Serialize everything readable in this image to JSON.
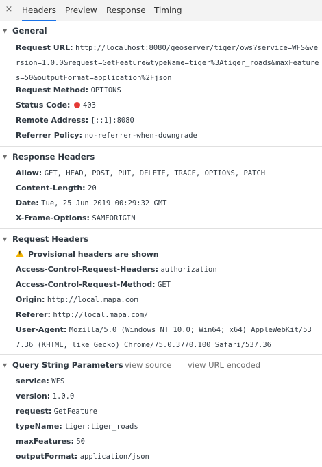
{
  "tabs": {
    "close_symbol": "×",
    "items": [
      "Headers",
      "Preview",
      "Response",
      "Timing"
    ],
    "active": "Headers"
  },
  "general": {
    "title": "General",
    "request_url_key": "Request URL:",
    "request_url_value": "http://localhost:8080/geoserver/tiger/ows?service=WFS&version=1.0.0&request=GetFeature&typeName=tiger%3Atiger_roads&maxFeatures=50&outputFormat=application%2Fjson",
    "request_method_key": "Request Method:",
    "request_method_value": "OPTIONS",
    "status_code_key": "Status Code:",
    "status_code_value": "403",
    "status_color": "#e53935",
    "remote_address_key": "Remote Address:",
    "remote_address_value": "[::1]:8080",
    "referrer_policy_key": "Referrer Policy:",
    "referrer_policy_value": "no-referrer-when-downgrade"
  },
  "response_headers": {
    "title": "Response Headers",
    "rows": [
      {
        "k": "Allow:",
        "v": "GET, HEAD, POST, PUT, DELETE, TRACE, OPTIONS, PATCH"
      },
      {
        "k": "Content-Length:",
        "v": "20"
      },
      {
        "k": "Date:",
        "v": "Tue, 25 Jun 2019 00:29:32 GMT"
      },
      {
        "k": "X-Frame-Options:",
        "v": "SAMEORIGIN"
      }
    ]
  },
  "request_headers": {
    "title": "Request Headers",
    "warning": "Provisional headers are shown",
    "rows": [
      {
        "k": "Access-Control-Request-Headers:",
        "v": "authorization"
      },
      {
        "k": "Access-Control-Request-Method:",
        "v": "GET"
      },
      {
        "k": "Origin:",
        "v": "http://local.mapa.com"
      },
      {
        "k": "Referer:",
        "v": "http://local.mapa.com/"
      }
    ],
    "user_agent_key": "User-Agent:",
    "user_agent_value": "Mozilla/5.0 (Windows NT 10.0; Win64; x64) AppleWebKit/537.36 (KHTML, like Gecko) Chrome/75.0.3770.100 Safari/537.36"
  },
  "query_string": {
    "title": "Query String Parameters",
    "view_source": "view source",
    "view_url_encoded": "view URL encoded",
    "rows": [
      {
        "k": "service:",
        "v": "WFS"
      },
      {
        "k": "version:",
        "v": "1.0.0"
      },
      {
        "k": "request:",
        "v": "GetFeature"
      },
      {
        "k": "typeName:",
        "v": "tiger:tiger_roads"
      },
      {
        "k": "maxFeatures:",
        "v": "50"
      },
      {
        "k": "outputFormat:",
        "v": "application/json"
      }
    ]
  }
}
